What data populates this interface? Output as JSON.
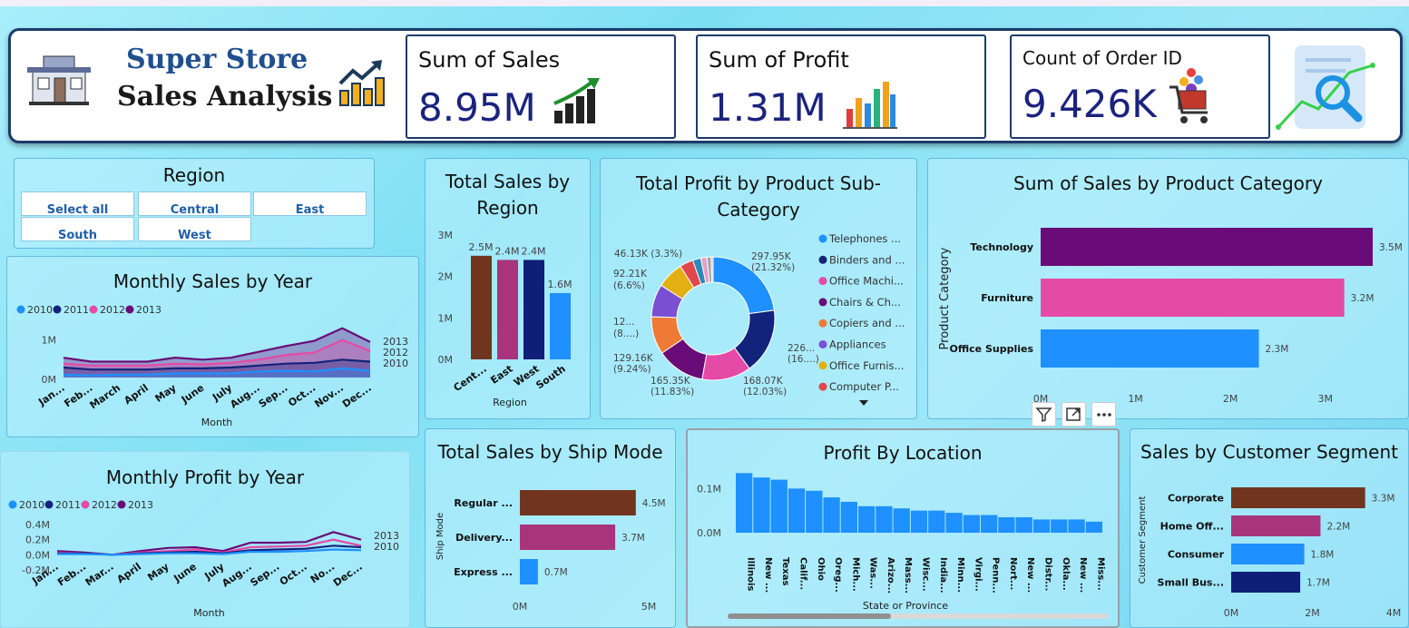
{
  "header": {
    "title_line1": "Super Store",
    "title_line2": "Sales Analysis",
    "kpis": [
      {
        "label": "Sum of Sales",
        "value": "8.95M"
      },
      {
        "label": "Sum of Profit",
        "value": "1.31M"
      },
      {
        "label": "Count of Order ID",
        "value": "9.426K"
      }
    ]
  },
  "region_slicer": {
    "title": "Region",
    "options": [
      "Select all",
      "Central",
      "East",
      "South",
      "West"
    ]
  },
  "colors": {
    "y2010": "#1e90ff",
    "y2011": "#12237c",
    "y2012": "#e44aa6",
    "y2013": "#6a0c77",
    "brown": "#71351f",
    "magenta": "#a8357b",
    "navy": "#0f1f78",
    "blue": "#1e90ff",
    "purple": "#6a0c77",
    "pink": "#e44aa6"
  },
  "visual_controls": [
    "filter-icon",
    "focus-mode-icon",
    "more-options-icon"
  ],
  "chart_data": [
    {
      "id": "monthly_sales",
      "type": "area",
      "title": "Monthly Sales by Year",
      "xlabel": "Month",
      "ylabel": "",
      "legend": [
        "2010",
        "2011",
        "2012",
        "2013"
      ],
      "end_labels": [
        "2013",
        "2012",
        "2010"
      ],
      "categories": [
        "Jan...",
        "Feb...",
        "March",
        "April",
        "May",
        "June",
        "July",
        "Aug...",
        "Sep...",
        "Oct...",
        "Nov...",
        "Dec..."
      ],
      "yticks": [
        "1M",
        "0M"
      ],
      "ylim": [
        0,
        1.5
      ],
      "series": [
        {
          "name": "2013",
          "values": [
            0.55,
            0.45,
            0.45,
            0.45,
            0.55,
            0.5,
            0.55,
            0.7,
            0.85,
            0.98,
            1.3,
            0.95
          ]
        },
        {
          "name": "2012",
          "values": [
            0.4,
            0.35,
            0.35,
            0.35,
            0.4,
            0.38,
            0.42,
            0.5,
            0.62,
            0.68,
            1.0,
            0.72
          ]
        },
        {
          "name": "2011",
          "values": [
            0.3,
            0.25,
            0.25,
            0.25,
            0.28,
            0.28,
            0.3,
            0.35,
            0.4,
            0.42,
            0.5,
            0.45
          ]
        },
        {
          "name": "2010",
          "values": [
            0.12,
            0.1,
            0.12,
            0.12,
            0.15,
            0.15,
            0.15,
            0.2,
            0.22,
            0.2,
            0.28,
            0.22
          ]
        }
      ]
    },
    {
      "id": "monthly_profit",
      "type": "line",
      "title": "Monthly Profit by Year",
      "xlabel": "Month",
      "ylabel": "",
      "legend": [
        "2010",
        "2011",
        "2012",
        "2013"
      ],
      "end_labels": [
        "2013",
        "2010"
      ],
      "categories": [
        "Jan...",
        "Feb...",
        "Mar...",
        "April",
        "May",
        "June",
        "July",
        "Aug...",
        "Sep...",
        "Oct...",
        "No...",
        "Dec..."
      ],
      "yticks": [
        "0.4M",
        "0.2M",
        "0.0M",
        "-0.2M"
      ],
      "ylim": [
        -0.2,
        0.4
      ],
      "series": [
        {
          "name": "2013",
          "values": [
            0.05,
            0.03,
            0.0,
            0.05,
            0.09,
            0.1,
            0.05,
            0.16,
            0.16,
            0.17,
            0.3,
            0.2
          ]
        },
        {
          "name": "2012",
          "values": [
            0.03,
            0.02,
            0.0,
            0.03,
            0.05,
            0.07,
            0.03,
            0.1,
            0.11,
            0.12,
            0.2,
            0.12
          ]
        },
        {
          "name": "2011",
          "values": [
            0.02,
            0.02,
            0.0,
            0.02,
            0.03,
            0.04,
            0.02,
            0.06,
            0.07,
            0.08,
            0.12,
            0.1
          ]
        },
        {
          "name": "2010",
          "values": [
            0.01,
            0.01,
            0.0,
            0.01,
            0.02,
            0.02,
            0.01,
            0.04,
            0.04,
            0.05,
            0.07,
            0.06
          ]
        }
      ]
    },
    {
      "id": "sales_by_region",
      "type": "bar",
      "title": "Total Sales by Region",
      "xlabel": "Region",
      "ylabel": "",
      "categories": [
        "Cent...",
        "East",
        "West",
        "South"
      ],
      "values": [
        2.5,
        2.4,
        2.4,
        1.6
      ],
      "data_labels": [
        "2.5M",
        "2.4M",
        "2.4M",
        "1.6M"
      ],
      "yticks": [
        "3M",
        "2M",
        "1M",
        "0M"
      ],
      "ylim": [
        0,
        3
      ]
    },
    {
      "id": "profit_by_subcategory",
      "type": "pie",
      "title": "Total Profit by Product Sub-Category",
      "categories": [
        "Telephones ...",
        "Binders and ...",
        "Office Machi...",
        "Chairs & Ch...",
        "Copiers and ...",
        "Appliances",
        "Office Furnis...",
        "Computer P..."
      ],
      "values": [
        21.32,
        16.0,
        12.03,
        11.83,
        9.24,
        8.0,
        6.6,
        3.3,
        2.0,
        1.5,
        1.0,
        0.5
      ],
      "data_labels": [
        "297.95K",
        "(21.32%)",
        "226...",
        "(16....)",
        "168.07K",
        "(12.03%)",
        "165.35K",
        "(11.83%)",
        "129.16K",
        "(9.24%)",
        "12...",
        "(8....)",
        "92.21K",
        "(6.6%)",
        "46.13K (3.3%)"
      ]
    },
    {
      "id": "sales_by_category",
      "type": "bar",
      "title": "Sum of Sales by Product Category",
      "xlabel": "",
      "ylabel": "Product Category",
      "categories": [
        "Technology",
        "Furniture",
        "Office Supplies"
      ],
      "values": [
        3.5,
        3.2,
        2.3
      ],
      "data_labels": [
        "3.5M",
        "3.2M",
        "2.3M"
      ],
      "xticks": [
        "0M",
        "1M",
        "2M",
        "3M"
      ],
      "xlim": [
        0,
        3.5
      ]
    },
    {
      "id": "sales_by_ship_mode",
      "type": "bar",
      "title": "Total Sales by Ship Mode",
      "xlabel": "",
      "ylabel": "Ship Mode",
      "categories": [
        "Regular ...",
        "Delivery...",
        "Express ..."
      ],
      "values": [
        4.5,
        3.7,
        0.7
      ],
      "data_labels": [
        "4.5M",
        "3.7M",
        "0.7M"
      ],
      "xticks": [
        "0M",
        "5M"
      ],
      "xlim": [
        0,
        5
      ]
    },
    {
      "id": "profit_by_location",
      "type": "bar",
      "title": "Profit By Location",
      "xlabel": "State or Province",
      "ylabel": "",
      "categories": [
        "Illinois",
        "New ...",
        "Texas",
        "Calif...",
        "Ohio",
        "Oreg...",
        "Mich...",
        "Was...",
        "Arizo...",
        "Mass...",
        "Wisc...",
        "India...",
        "Minn...",
        "Virgi...",
        "Penn...",
        "Nort...",
        "New ...",
        "Distr...",
        "Okla...",
        "New ...",
        "Miss..."
      ],
      "values": [
        0.135,
        0.125,
        0.12,
        0.1,
        0.095,
        0.08,
        0.07,
        0.06,
        0.06,
        0.055,
        0.05,
        0.05,
        0.045,
        0.04,
        0.04,
        0.035,
        0.035,
        0.03,
        0.03,
        0.03,
        0.025
      ],
      "yticks": [
        "0.1M",
        "0.0M"
      ],
      "ylim": [
        0,
        0.15
      ]
    },
    {
      "id": "sales_by_segment",
      "type": "bar",
      "title": "Sales by Customer Segment",
      "xlabel": "",
      "ylabel": "Customer Segment",
      "categories": [
        "Corporate",
        "Home Off...",
        "Consumer",
        "Small Bus..."
      ],
      "values": [
        3.3,
        2.2,
        1.8,
        1.7
      ],
      "data_labels": [
        "3.3M",
        "2.2M",
        "1.8M",
        "1.7M"
      ],
      "xticks": [
        "0M",
        "2M",
        "4M"
      ],
      "xlim": [
        0,
        4
      ]
    }
  ]
}
